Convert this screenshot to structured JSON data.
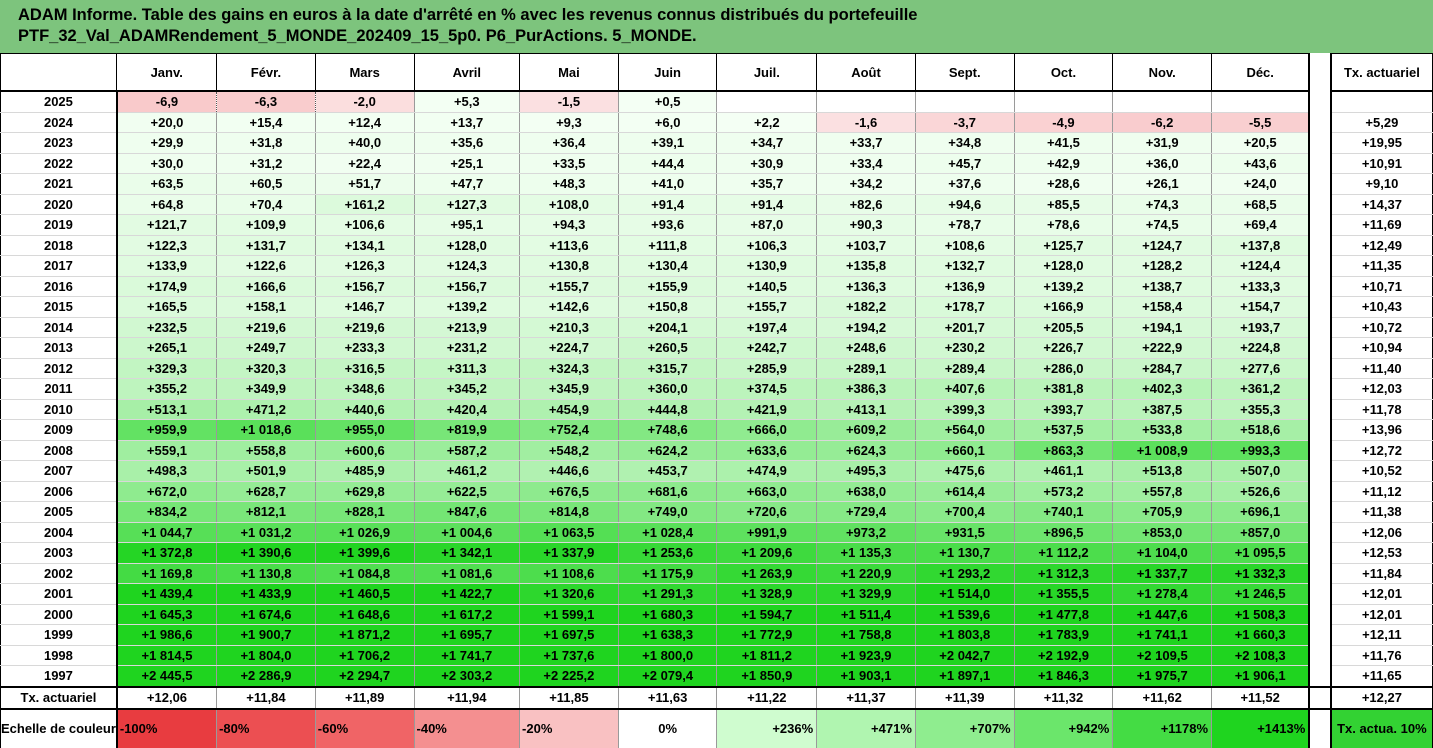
{
  "header": {
    "line1": "ADAM Informe. Table des gains en euros à la date d'arrêté en % avec les revenus connus distribués du portefeuille",
    "line2": "PTF_32_Val_ADAMRendement_5_MONDE_202409_15_5p0. P6_PurActions. 5_MONDE."
  },
  "table": {
    "months": [
      "Janv.",
      "Févr.",
      "Mars",
      "Avril",
      "Mai",
      "Juin",
      "Juil.",
      "Août",
      "Sept.",
      "Oct.",
      "Nov.",
      "Déc."
    ],
    "rate_header": "Tx. actuariel",
    "rows": [
      {
        "year": "2025",
        "values": [
          "-6,9",
          "-6,3",
          "-2,0",
          "+5,3",
          "-1,5",
          "+0,5",
          "",
          "",
          "",
          "",
          "",
          ""
        ],
        "rate": ""
      },
      {
        "year": "2024",
        "values": [
          "+20,0",
          "+15,4",
          "+12,4",
          "+13,7",
          "+9,3",
          "+6,0",
          "+2,2",
          "-1,6",
          "-3,7",
          "-4,9",
          "-6,2",
          "-5,5"
        ],
        "rate": "+5,29"
      },
      {
        "year": "2023",
        "values": [
          "+29,9",
          "+31,8",
          "+40,0",
          "+35,6",
          "+36,4",
          "+39,1",
          "+34,7",
          "+33,7",
          "+34,8",
          "+41,5",
          "+31,9",
          "+20,5"
        ],
        "rate": "+19,95"
      },
      {
        "year": "2022",
        "values": [
          "+30,0",
          "+31,2",
          "+22,4",
          "+25,1",
          "+33,5",
          "+44,4",
          "+30,9",
          "+33,4",
          "+45,7",
          "+42,9",
          "+36,0",
          "+43,6"
        ],
        "rate": "+10,91"
      },
      {
        "year": "2021",
        "values": [
          "+63,5",
          "+60,5",
          "+51,7",
          "+47,7",
          "+48,3",
          "+41,0",
          "+35,7",
          "+34,2",
          "+37,6",
          "+28,6",
          "+26,1",
          "+24,0"
        ],
        "rate": "+9,10"
      },
      {
        "year": "2020",
        "values": [
          "+64,8",
          "+70,4",
          "+161,2",
          "+127,3",
          "+108,0",
          "+91,4",
          "+91,4",
          "+82,6",
          "+94,6",
          "+85,5",
          "+74,3",
          "+68,5"
        ],
        "rate": "+14,37"
      },
      {
        "year": "2019",
        "values": [
          "+121,7",
          "+109,9",
          "+106,6",
          "+95,1",
          "+94,3",
          "+93,6",
          "+87,0",
          "+90,3",
          "+78,7",
          "+78,6",
          "+74,5",
          "+69,4"
        ],
        "rate": "+11,69"
      },
      {
        "year": "2018",
        "values": [
          "+122,3",
          "+131,7",
          "+134,1",
          "+128,0",
          "+113,6",
          "+111,8",
          "+106,3",
          "+103,7",
          "+108,6",
          "+125,7",
          "+124,7",
          "+137,8"
        ],
        "rate": "+12,49"
      },
      {
        "year": "2017",
        "values": [
          "+133,9",
          "+122,6",
          "+126,3",
          "+124,3",
          "+130,8",
          "+130,4",
          "+130,9",
          "+135,8",
          "+132,7",
          "+128,0",
          "+128,2",
          "+124,4"
        ],
        "rate": "+11,35"
      },
      {
        "year": "2016",
        "values": [
          "+174,9",
          "+166,6",
          "+156,7",
          "+156,7",
          "+155,7",
          "+155,9",
          "+140,5",
          "+136,3",
          "+136,9",
          "+139,2",
          "+138,7",
          "+133,3"
        ],
        "rate": "+10,71"
      },
      {
        "year": "2015",
        "values": [
          "+165,5",
          "+158,1",
          "+146,7",
          "+139,2",
          "+142,6",
          "+150,8",
          "+155,7",
          "+182,2",
          "+178,7",
          "+166,9",
          "+158,4",
          "+154,7"
        ],
        "rate": "+10,43"
      },
      {
        "year": "2014",
        "values": [
          "+232,5",
          "+219,6",
          "+219,6",
          "+213,9",
          "+210,3",
          "+204,1",
          "+197,4",
          "+194,2",
          "+201,7",
          "+205,5",
          "+194,1",
          "+193,7"
        ],
        "rate": "+10,72"
      },
      {
        "year": "2013",
        "values": [
          "+265,1",
          "+249,7",
          "+233,3",
          "+231,2",
          "+224,7",
          "+260,5",
          "+242,7",
          "+248,6",
          "+230,2",
          "+226,7",
          "+222,9",
          "+224,8"
        ],
        "rate": "+10,94"
      },
      {
        "year": "2012",
        "values": [
          "+329,3",
          "+320,3",
          "+316,5",
          "+311,3",
          "+324,3",
          "+315,7",
          "+285,9",
          "+289,1",
          "+289,4",
          "+286,0",
          "+284,7",
          "+277,6"
        ],
        "rate": "+11,40"
      },
      {
        "year": "2011",
        "values": [
          "+355,2",
          "+349,9",
          "+348,6",
          "+345,2",
          "+345,9",
          "+360,0",
          "+374,5",
          "+386,3",
          "+407,6",
          "+381,8",
          "+402,3",
          "+361,2"
        ],
        "rate": "+12,03"
      },
      {
        "year": "2010",
        "values": [
          "+513,1",
          "+471,2",
          "+440,6",
          "+420,4",
          "+454,9",
          "+444,8",
          "+421,9",
          "+413,1",
          "+399,3",
          "+393,7",
          "+387,5",
          "+355,3"
        ],
        "rate": "+11,78"
      },
      {
        "year": "2009",
        "values": [
          "+959,9",
          "+1 018,6",
          "+955,0",
          "+819,9",
          "+752,4",
          "+748,6",
          "+666,0",
          "+609,2",
          "+564,0",
          "+537,5",
          "+533,8",
          "+518,6"
        ],
        "rate": "+13,96"
      },
      {
        "year": "2008",
        "values": [
          "+559,1",
          "+558,8",
          "+600,6",
          "+587,2",
          "+548,2",
          "+624,2",
          "+633,6",
          "+624,3",
          "+660,1",
          "+863,3",
          "+1 008,9",
          "+993,3"
        ],
        "rate": "+12,72"
      },
      {
        "year": "2007",
        "values": [
          "+498,3",
          "+501,9",
          "+485,9",
          "+461,2",
          "+446,6",
          "+453,7",
          "+474,9",
          "+495,3",
          "+475,6",
          "+461,1",
          "+513,8",
          "+507,0"
        ],
        "rate": "+10,52"
      },
      {
        "year": "2006",
        "values": [
          "+672,0",
          "+628,7",
          "+629,8",
          "+622,5",
          "+676,5",
          "+681,6",
          "+663,0",
          "+638,0",
          "+614,4",
          "+573,2",
          "+557,8",
          "+526,6"
        ],
        "rate": "+11,12"
      },
      {
        "year": "2005",
        "values": [
          "+834,2",
          "+812,1",
          "+828,1",
          "+847,6",
          "+814,8",
          "+749,0",
          "+720,6",
          "+729,4",
          "+700,4",
          "+740,1",
          "+705,9",
          "+696,1"
        ],
        "rate": "+11,38"
      },
      {
        "year": "2004",
        "values": [
          "+1 044,7",
          "+1 031,2",
          "+1 026,9",
          "+1 004,6",
          "+1 063,5",
          "+1 028,4",
          "+991,9",
          "+973,2",
          "+931,5",
          "+896,5",
          "+853,0",
          "+857,0"
        ],
        "rate": "+12,06"
      },
      {
        "year": "2003",
        "values": [
          "+1 372,8",
          "+1 390,6",
          "+1 399,6",
          "+1 342,1",
          "+1 337,9",
          "+1 253,6",
          "+1 209,6",
          "+1 135,3",
          "+1 130,7",
          "+1 112,2",
          "+1 104,0",
          "+1 095,5"
        ],
        "rate": "+12,53"
      },
      {
        "year": "2002",
        "values": [
          "+1 169,8",
          "+1 130,8",
          "+1 084,8",
          "+1 081,6",
          "+1 108,6",
          "+1 175,9",
          "+1 263,9",
          "+1 220,9",
          "+1 293,2",
          "+1 312,3",
          "+1 337,7",
          "+1 332,3"
        ],
        "rate": "+11,84"
      },
      {
        "year": "2001",
        "values": [
          "+1 439,4",
          "+1 433,9",
          "+1 460,5",
          "+1 422,7",
          "+1 320,6",
          "+1 291,3",
          "+1 328,9",
          "+1 329,9",
          "+1 514,0",
          "+1 355,5",
          "+1 278,4",
          "+1 246,5"
        ],
        "rate": "+12,01"
      },
      {
        "year": "2000",
        "values": [
          "+1 645,3",
          "+1 674,6",
          "+1 648,6",
          "+1 617,2",
          "+1 599,1",
          "+1 680,3",
          "+1 594,7",
          "+1 511,4",
          "+1 539,6",
          "+1 477,8",
          "+1 447,6",
          "+1 508,3"
        ],
        "rate": "+12,01"
      },
      {
        "year": "1999",
        "values": [
          "+1 986,6",
          "+1 900,7",
          "+1 871,2",
          "+1 695,7",
          "+1 697,5",
          "+1 638,3",
          "+1 772,9",
          "+1 758,8",
          "+1 803,8",
          "+1 783,9",
          "+1 741,1",
          "+1 660,3"
        ],
        "rate": "+12,11"
      },
      {
        "year": "1998",
        "values": [
          "+1 814,5",
          "+1 804,0",
          "+1 706,2",
          "+1 741,7",
          "+1 737,6",
          "+1 800,0",
          "+1 811,2",
          "+1 923,9",
          "+2 042,7",
          "+2 192,9",
          "+2 109,5",
          "+2 108,3"
        ],
        "rate": "+11,76"
      },
      {
        "year": "1997",
        "values": [
          "+2 445,5",
          "+2 286,9",
          "+2 294,7",
          "+2 303,2",
          "+2 225,2",
          "+2 079,4",
          "+1 850,9",
          "+1 903,1",
          "+1 897,1",
          "+1 846,3",
          "+1 975,7",
          "+1 906,1"
        ],
        "rate": "+11,65"
      }
    ],
    "average_row": {
      "label": "Tx. actuariel",
      "values": [
        "+12,06",
        "+11,84",
        "+11,89",
        "+11,94",
        "+11,85",
        "+11,63",
        "+11,22",
        "+11,37",
        "+11,39",
        "+11,32",
        "+11,62",
        "+11,52"
      ],
      "rate": "+12,27"
    },
    "scale": {
      "label": "Echelle de couleur",
      "items": [
        {
          "text": "-100%",
          "color": "#e83c40"
        },
        {
          "text": "-80%",
          "color": "#ec4f52"
        },
        {
          "text": "-60%",
          "color": "#f06466"
        },
        {
          "text": "-40%",
          "color": "#f48f90"
        },
        {
          "text": "-20%",
          "color": "#f9c1c2"
        },
        {
          "text": "0%",
          "color": "#ffffff"
        },
        {
          "text": "+236%",
          "color": "#cffccf"
        },
        {
          "text": "+471%",
          "color": "#b0f5b0"
        },
        {
          "text": "+707%",
          "color": "#8fed8f"
        },
        {
          "text": "+942%",
          "color": "#6be66b"
        },
        {
          "text": "+1178%",
          "color": "#44dc44"
        },
        {
          "text": "+1413%",
          "color": "#1fd41f"
        }
      ],
      "rate_legend": "Tx. actua. 10%"
    }
  }
}
